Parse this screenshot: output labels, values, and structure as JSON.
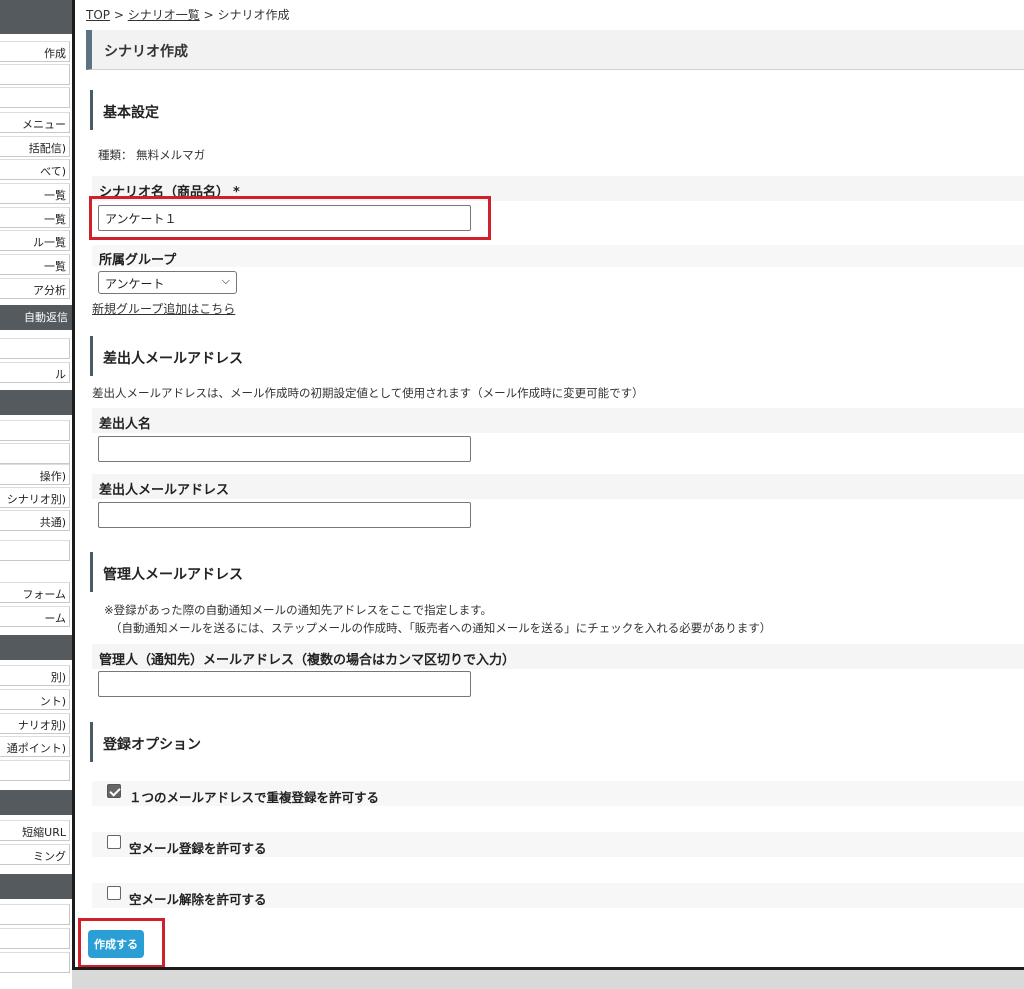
{
  "sidebar": {
    "headers": [
      "",
      "",
      "",
      "",
      ""
    ],
    "items": [
      "作成",
      "",
      "",
      "メニュー",
      "括配信)",
      "べて)",
      "一覧",
      "一覧",
      "ル一覧",
      "一覧",
      "ア分析",
      "自動返信",
      "",
      "ル",
      "",
      "",
      "操作)",
      "シナリオ別)",
      "共通)",
      "",
      "フォーム",
      "ーム",
      "",
      "別)",
      "ント)",
      "ナリオ別)",
      "通ポイント)",
      "",
      "",
      "短縮URL",
      "ミング",
      "",
      "",
      ""
    ]
  },
  "breadcrumb": {
    "top": "TOP",
    "sep1": ">",
    "list": "シナリオ一覧",
    "sep2": ">",
    "current": "シナリオ作成"
  },
  "page_title": "シナリオ作成",
  "basic": {
    "heading": "基本設定",
    "type_text": "種類： 無料メルマガ",
    "name_label": "シナリオ名（商品名）",
    "name_required": "*",
    "name_value": "アンケート１",
    "group_label": "所属グループ",
    "group_selected": "アンケート",
    "group_link": "新規グループ追加はこちら"
  },
  "sender": {
    "heading": "差出人メールアドレス",
    "note": "差出人メールアドレスは、メール作成時の初期設定値として使用されます（メール作成時に変更可能です）",
    "name_label": "差出人名",
    "name_value": "",
    "address_label": "差出人メールアドレス",
    "address_value": ""
  },
  "admin": {
    "heading": "管理人メールアドレス",
    "note1": "※登録があった際の自動通知メールの通知先アドレスをここで指定します。",
    "note2": "（自動通知メールを送るには、ステップメールの作成時、「販売者への通知メールを送る」にチェックを入れる必要があります）",
    "address_label": "管理人（通知先）メールアドレス（複数の場合はカンマ区切りで入力）",
    "address_value": ""
  },
  "options": {
    "heading": "登録オプション",
    "items": [
      {
        "label": "１つのメールアドレスで重複登録を許可する",
        "checked": true
      },
      {
        "label": "空メール登録を許可する",
        "checked": false
      },
      {
        "label": "空メール解除を許可する",
        "checked": false
      }
    ]
  },
  "submit_label": "作成する",
  "colors": {
    "accent": "#2a9fd6",
    "highlight": "#d0202a",
    "sidebar_header": "#555a5f",
    "section_bar": "#4a5a66"
  }
}
